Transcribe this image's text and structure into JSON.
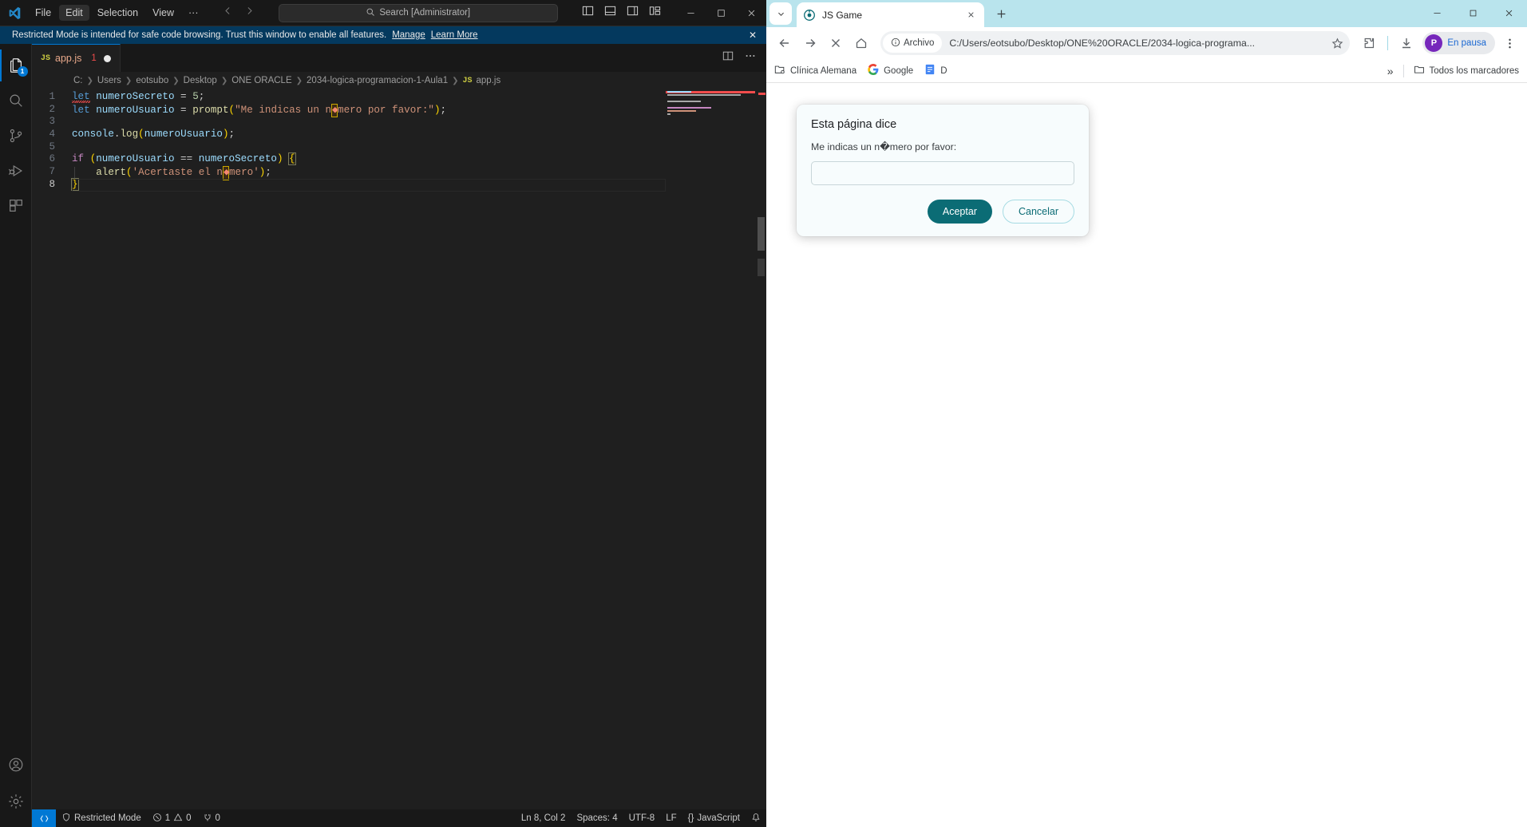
{
  "vscode": {
    "menu": [
      {
        "label": "File",
        "active": false
      },
      {
        "label": "Edit",
        "active": true
      },
      {
        "label": "Selection",
        "active": false
      },
      {
        "label": "View",
        "active": false
      },
      {
        "label": "···",
        "active": false
      }
    ],
    "search_placeholder": "Search [Administrator]",
    "search_icon": "magnifier-icon",
    "notification": {
      "icon": "shield-icon",
      "text": "Restricted Mode is intended for safe code browsing. Trust this window to enable all features.",
      "link_manage": "Manage",
      "link_learn": "Learn More",
      "close": "✕"
    },
    "activity_items": [
      {
        "name": "explorer",
        "badge": "1",
        "selected": true
      },
      {
        "name": "search",
        "badge": "",
        "selected": false
      },
      {
        "name": "source-control",
        "badge": "",
        "selected": false
      },
      {
        "name": "run-and-debug",
        "badge": "",
        "selected": false
      },
      {
        "name": "extensions",
        "badge": "",
        "selected": false
      }
    ],
    "tab": {
      "file_icon_label": "JS",
      "filename": "app.js",
      "error_count": "1",
      "dirty": true
    },
    "breadcrumb": [
      "C:",
      "Users",
      "eotsubo",
      "Desktop",
      "ONE ORACLE",
      "2034-logica-programacion-1-Aula1",
      "app.js"
    ],
    "breadcrumb_file_icon": "JS",
    "code_lines": [
      {
        "n": "1",
        "text": "let numeroSecreto = 5;"
      },
      {
        "n": "2",
        "text": "let numeroUsuario = prompt(\"Me indicas un n�mero por favor:\");"
      },
      {
        "n": "3",
        "text": ""
      },
      {
        "n": "4",
        "text": "console.log(numeroUsuario);"
      },
      {
        "n": "5",
        "text": ""
      },
      {
        "n": "6",
        "text": "if (numeroUsuario == numeroSecreto) {"
      },
      {
        "n": "7",
        "text": "    alert('Acertaste el n�mero');"
      },
      {
        "n": "8",
        "text": "}"
      }
    ],
    "status": {
      "remote_icon": "remote-window-icon",
      "restricted_mode": "Restricted Mode",
      "restricted_icon": "shield-icon",
      "errors": "1",
      "warnings": "0",
      "ports": "0",
      "cursor_position": "Ln 8, Col 2",
      "indentation": "Spaces: 4",
      "encoding": "UTF-8",
      "eol": "LF",
      "language": "JavaScript",
      "bell_icon": "bell-icon"
    }
  },
  "browser": {
    "tab": {
      "title": "JS Game",
      "favicon": "globe-icon",
      "close_icon": "close-icon"
    },
    "tab_list_icon": "chevron-down-icon",
    "new_tab_icon": "plus-icon",
    "window_controls": [
      "minimize-icon",
      "maximize-icon",
      "close-icon"
    ],
    "toolbar": {
      "back_icon": "arrow-left-icon",
      "forward_icon": "arrow-right-icon",
      "stop_icon": "close-icon",
      "home_icon": "home-icon",
      "file_chip_label": "Archivo",
      "file_chip_icon": "info-circle-icon",
      "url": "C:/Users/eotsubo/Desktop/ONE%20ORACLE/2034-logica-programa...",
      "star_icon": "star-icon",
      "extensions_icon": "puzzle-icon",
      "downloads_icon": "download-icon",
      "profile_initial": "P",
      "profile_label": "En pausa",
      "menu_icon": "three-dots-vertical-icon"
    },
    "bookmarks": [
      {
        "label": "Clínica Alemana",
        "icon": "folder-settings-icon"
      },
      {
        "label": "Google",
        "icon": "google-icon"
      },
      {
        "label": "D",
        "icon": "docs-icon"
      }
    ],
    "bookmarks_overflow_icon": "chevron-double-right-icon",
    "bookmarks_all_label": "Todos los marcadores",
    "bookmarks_all_icon": "folder-icon",
    "dialog": {
      "title": "Esta página dice",
      "message": "Me indicas un n�mero por favor:",
      "input_value": "",
      "accept_label": "Aceptar",
      "cancel_label": "Cancelar",
      "accent_color": "#0b6c75"
    }
  }
}
